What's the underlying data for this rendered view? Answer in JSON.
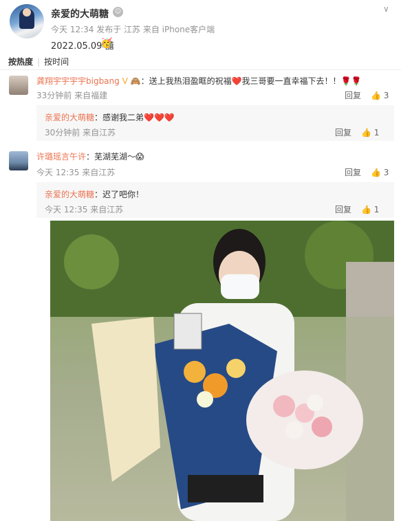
{
  "post": {
    "author": "亲爱的大萌糖",
    "meta": "今天 12:34 发布于 江苏 来自 iPhone客户端",
    "text": "2022.05.09 囍",
    "emoji": "🥳",
    "avatar_icon": "avatar"
  },
  "sort": {
    "hot": "按热度",
    "sep": "|",
    "time": "按时间"
  },
  "comments": [
    {
      "user": "龚翔宇宇宇宇bigbang",
      "badges": "V 🙈",
      "text": "：送上我热泪盈眶的祝福❤️我三哥要一直幸福下去！！🌹🌹",
      "meta": "33分钟前 来自福建",
      "reply_label": "回复",
      "likes": "3",
      "reply": {
        "user": "亲爱的大萌糖",
        "text": "：感谢我二弟❤️❤️❤️",
        "meta": "30分钟前 来自江苏",
        "reply_label": "回复",
        "likes": "1"
      }
    },
    {
      "user": "许璐瑶言午许",
      "text": "：芜湖芜湖～😱",
      "meta": "今天 12:35 来自江苏",
      "reply_label": "回复",
      "likes": "3",
      "reply": {
        "user": "亲爱的大萌糖",
        "text": "：迟了吧你！",
        "meta": "今天 12:35 来自江苏",
        "reply_label": "回复",
        "likes": "1"
      }
    }
  ],
  "icons": {
    "like": "thumbs-up-icon",
    "chevron": "chevron-down-icon",
    "robot": "robot-icon"
  },
  "colors": {
    "username": "#eb7350",
    "meta": "#939393",
    "heart": "#e0324b"
  }
}
